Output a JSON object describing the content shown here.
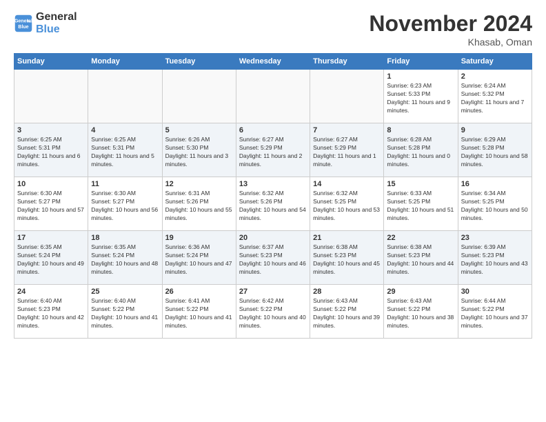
{
  "logo": {
    "line1": "General",
    "line2": "Blue"
  },
  "title": "November 2024",
  "location": "Khasab, Oman",
  "days_header": [
    "Sunday",
    "Monday",
    "Tuesday",
    "Wednesday",
    "Thursday",
    "Friday",
    "Saturday"
  ],
  "weeks": [
    [
      {
        "day": "",
        "detail": ""
      },
      {
        "day": "",
        "detail": ""
      },
      {
        "day": "",
        "detail": ""
      },
      {
        "day": "",
        "detail": ""
      },
      {
        "day": "",
        "detail": ""
      },
      {
        "day": "1",
        "detail": "Sunrise: 6:23 AM\nSunset: 5:33 PM\nDaylight: 11 hours and 9 minutes."
      },
      {
        "day": "2",
        "detail": "Sunrise: 6:24 AM\nSunset: 5:32 PM\nDaylight: 11 hours and 7 minutes."
      }
    ],
    [
      {
        "day": "3",
        "detail": "Sunrise: 6:25 AM\nSunset: 5:31 PM\nDaylight: 11 hours and 6 minutes."
      },
      {
        "day": "4",
        "detail": "Sunrise: 6:25 AM\nSunset: 5:31 PM\nDaylight: 11 hours and 5 minutes."
      },
      {
        "day": "5",
        "detail": "Sunrise: 6:26 AM\nSunset: 5:30 PM\nDaylight: 11 hours and 3 minutes."
      },
      {
        "day": "6",
        "detail": "Sunrise: 6:27 AM\nSunset: 5:29 PM\nDaylight: 11 hours and 2 minutes."
      },
      {
        "day": "7",
        "detail": "Sunrise: 6:27 AM\nSunset: 5:29 PM\nDaylight: 11 hours and 1 minute."
      },
      {
        "day": "8",
        "detail": "Sunrise: 6:28 AM\nSunset: 5:28 PM\nDaylight: 11 hours and 0 minutes."
      },
      {
        "day": "9",
        "detail": "Sunrise: 6:29 AM\nSunset: 5:28 PM\nDaylight: 10 hours and 58 minutes."
      }
    ],
    [
      {
        "day": "10",
        "detail": "Sunrise: 6:30 AM\nSunset: 5:27 PM\nDaylight: 10 hours and 57 minutes."
      },
      {
        "day": "11",
        "detail": "Sunrise: 6:30 AM\nSunset: 5:27 PM\nDaylight: 10 hours and 56 minutes."
      },
      {
        "day": "12",
        "detail": "Sunrise: 6:31 AM\nSunset: 5:26 PM\nDaylight: 10 hours and 55 minutes."
      },
      {
        "day": "13",
        "detail": "Sunrise: 6:32 AM\nSunset: 5:26 PM\nDaylight: 10 hours and 54 minutes."
      },
      {
        "day": "14",
        "detail": "Sunrise: 6:32 AM\nSunset: 5:25 PM\nDaylight: 10 hours and 53 minutes."
      },
      {
        "day": "15",
        "detail": "Sunrise: 6:33 AM\nSunset: 5:25 PM\nDaylight: 10 hours and 51 minutes."
      },
      {
        "day": "16",
        "detail": "Sunrise: 6:34 AM\nSunset: 5:25 PM\nDaylight: 10 hours and 50 minutes."
      }
    ],
    [
      {
        "day": "17",
        "detail": "Sunrise: 6:35 AM\nSunset: 5:24 PM\nDaylight: 10 hours and 49 minutes."
      },
      {
        "day": "18",
        "detail": "Sunrise: 6:35 AM\nSunset: 5:24 PM\nDaylight: 10 hours and 48 minutes."
      },
      {
        "day": "19",
        "detail": "Sunrise: 6:36 AM\nSunset: 5:24 PM\nDaylight: 10 hours and 47 minutes."
      },
      {
        "day": "20",
        "detail": "Sunrise: 6:37 AM\nSunset: 5:23 PM\nDaylight: 10 hours and 46 minutes."
      },
      {
        "day": "21",
        "detail": "Sunrise: 6:38 AM\nSunset: 5:23 PM\nDaylight: 10 hours and 45 minutes."
      },
      {
        "day": "22",
        "detail": "Sunrise: 6:38 AM\nSunset: 5:23 PM\nDaylight: 10 hours and 44 minutes."
      },
      {
        "day": "23",
        "detail": "Sunrise: 6:39 AM\nSunset: 5:23 PM\nDaylight: 10 hours and 43 minutes."
      }
    ],
    [
      {
        "day": "24",
        "detail": "Sunrise: 6:40 AM\nSunset: 5:23 PM\nDaylight: 10 hours and 42 minutes."
      },
      {
        "day": "25",
        "detail": "Sunrise: 6:40 AM\nSunset: 5:22 PM\nDaylight: 10 hours and 41 minutes."
      },
      {
        "day": "26",
        "detail": "Sunrise: 6:41 AM\nSunset: 5:22 PM\nDaylight: 10 hours and 41 minutes."
      },
      {
        "day": "27",
        "detail": "Sunrise: 6:42 AM\nSunset: 5:22 PM\nDaylight: 10 hours and 40 minutes."
      },
      {
        "day": "28",
        "detail": "Sunrise: 6:43 AM\nSunset: 5:22 PM\nDaylight: 10 hours and 39 minutes."
      },
      {
        "day": "29",
        "detail": "Sunrise: 6:43 AM\nSunset: 5:22 PM\nDaylight: 10 hours and 38 minutes."
      },
      {
        "day": "30",
        "detail": "Sunrise: 6:44 AM\nSunset: 5:22 PM\nDaylight: 10 hours and 37 minutes."
      }
    ]
  ]
}
